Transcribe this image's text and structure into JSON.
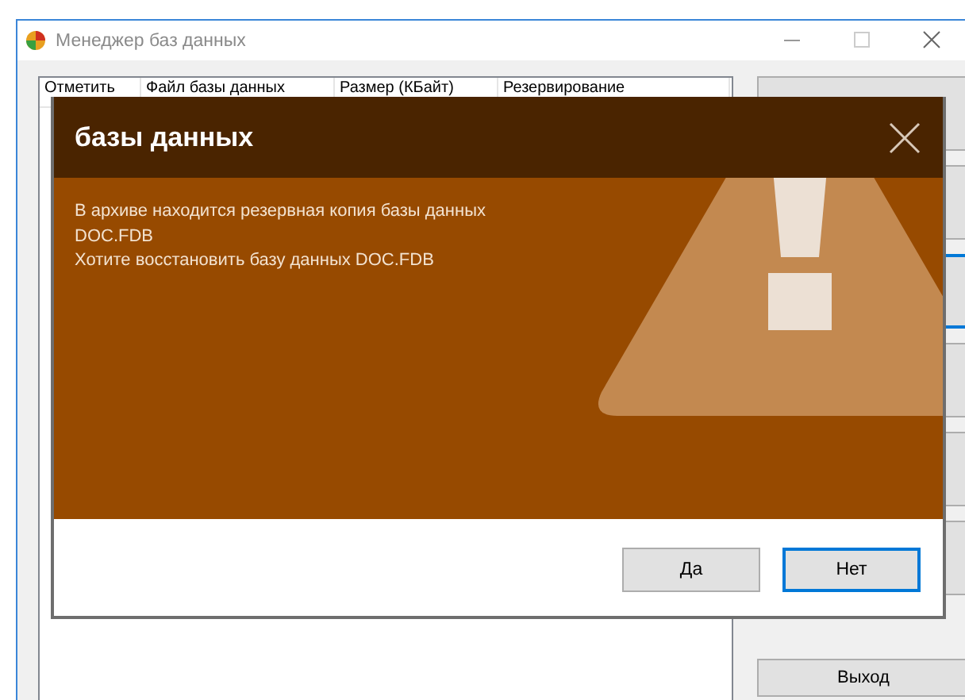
{
  "window": {
    "title": "Менеджер баз данных"
  },
  "table": {
    "columns": [
      "Отметить",
      "Файл базы данных",
      "Размер (КБайт)",
      "Резервирование"
    ]
  },
  "side_buttons": [
    {
      "focused": false
    },
    {
      "focused": false
    },
    {
      "focused": true
    },
    {
      "focused": false
    },
    {
      "focused": false
    },
    {
      "focused": false
    }
  ],
  "exit_button": {
    "label": "Выход"
  },
  "dialog": {
    "title": "базы данных",
    "lines": [
      "В архиве находится резервная копия базы данных",
      "DOC.FDB",
      "Хотите восстановить базу данных DOC.FDB"
    ],
    "buttons": [
      {
        "label": "Да",
        "default": false
      },
      {
        "label": "Нет",
        "default": true
      }
    ]
  }
}
